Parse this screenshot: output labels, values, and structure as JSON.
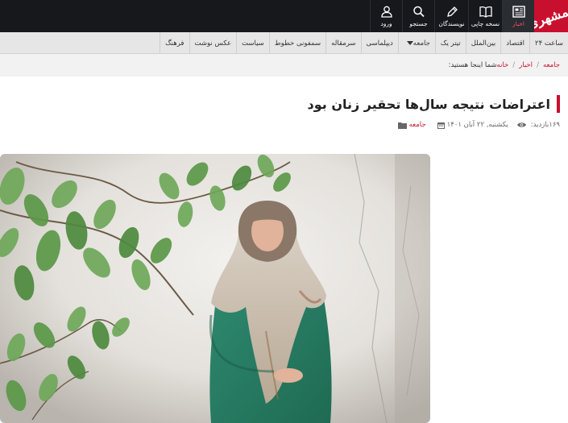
{
  "site": {
    "logo_text": "همشهری",
    "brand_color": "#c8102e",
    "topbar_color": "#16181c"
  },
  "topbar": {
    "items": [
      {
        "label": "اخبار",
        "icon": "newspaper-icon",
        "active": true
      },
      {
        "label": "نسخه چاپی",
        "icon": "book-icon",
        "active": false
      },
      {
        "label": "نویسندگان",
        "icon": "pen-icon",
        "active": false
      },
      {
        "label": "جستجو",
        "icon": "search-icon",
        "active": false
      },
      {
        "label": "ورود",
        "icon": "user-icon",
        "active": false
      }
    ]
  },
  "menu": {
    "items": [
      "۲۴ ساعت",
      "اقتصاد",
      "بین‌الملل",
      "تیتر یک",
      "جامعه",
      "دیپلماسی",
      "سرمقاله",
      "سمفونی خطوط",
      "سیاست",
      "عکس نوشت",
      "فرهنگ"
    ]
  },
  "breadcrumb": {
    "lead": "شما اینجا هستید:",
    "items": [
      "خانه",
      "اخبار",
      "جامعه"
    ],
    "separator": "/"
  },
  "article": {
    "title": "اعتراضات نتیجه سال‌ها تحقیر زنان بود",
    "category": "جامعه",
    "date": "یکشنبه, ۲۲ آبان ۱۴۰۱",
    "views_label": "بازدید:",
    "views": "۱۶۹",
    "image_alt": "woman-in-green-coat-photo"
  }
}
